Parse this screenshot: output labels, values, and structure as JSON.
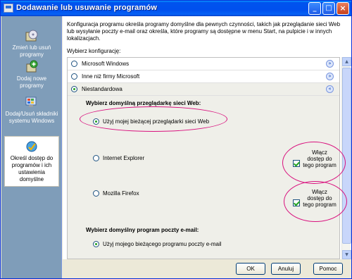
{
  "window": {
    "title": "Dodawanie lub usuwanie programów",
    "controls": {
      "minimize": "_",
      "maximize": "□",
      "close": "×"
    }
  },
  "sidebar": {
    "items": [
      {
        "label": "Zmień lub usuń programy",
        "icon": "programs-cd-icon"
      },
      {
        "label": "Dodaj nowe programy",
        "icon": "add-program-icon"
      },
      {
        "label": "Dodaj/Usuń składniki systemu Windows",
        "icon": "windows-components-icon"
      },
      {
        "label": "Określ dostęp do programów i ich ustawienia domyślne",
        "icon": "program-access-icon",
        "active": true
      }
    ]
  },
  "content": {
    "description": "Konfiguracja programu określa programy domyślne dla pewnych czynności, takich jak przeglądanie sieci Web lub wysyłanie poczty e-mail oraz określa, które programy są dostępne w menu Start, na pulpicie i w innych lokalizacjach.",
    "choose_label": "Wybierz konfigurację:",
    "configs": [
      {
        "label": "Microsoft Windows",
        "selected": false,
        "expand_glyph": "»"
      },
      {
        "label": "Inne niż firmy Microsoft",
        "selected": false,
        "expand_glyph": "»"
      },
      {
        "label": "Niestandardowa",
        "selected": true,
        "expand_glyph": "«"
      }
    ],
    "browser_section": {
      "title": "Wybierz domyślną przeglądarkę sieci Web:",
      "options": [
        {
          "label": "Użyj mojej bieżącej przeglądarki sieci Web",
          "selected": true
        },
        {
          "label": "Internet Explorer",
          "selected": false,
          "access_label": "Włącz dostęp do tego program",
          "access_checked": true
        },
        {
          "label": "Mozilla Firefox",
          "selected": false,
          "access_label": "Włącz dostęp do tego program",
          "access_checked": true
        }
      ]
    },
    "email_section": {
      "title": "Wybierz domyślny program poczty e-mail:",
      "options": [
        {
          "label": "Użyj mojego bieżącego programu poczty e-mail",
          "selected": true
        }
      ]
    }
  },
  "buttons": {
    "ok": "OK",
    "cancel": "Anuluj",
    "help": "Pomoc"
  },
  "annotation_color": "#d9117e",
  "scroll": {
    "up": "▲",
    "down": "▼"
  }
}
